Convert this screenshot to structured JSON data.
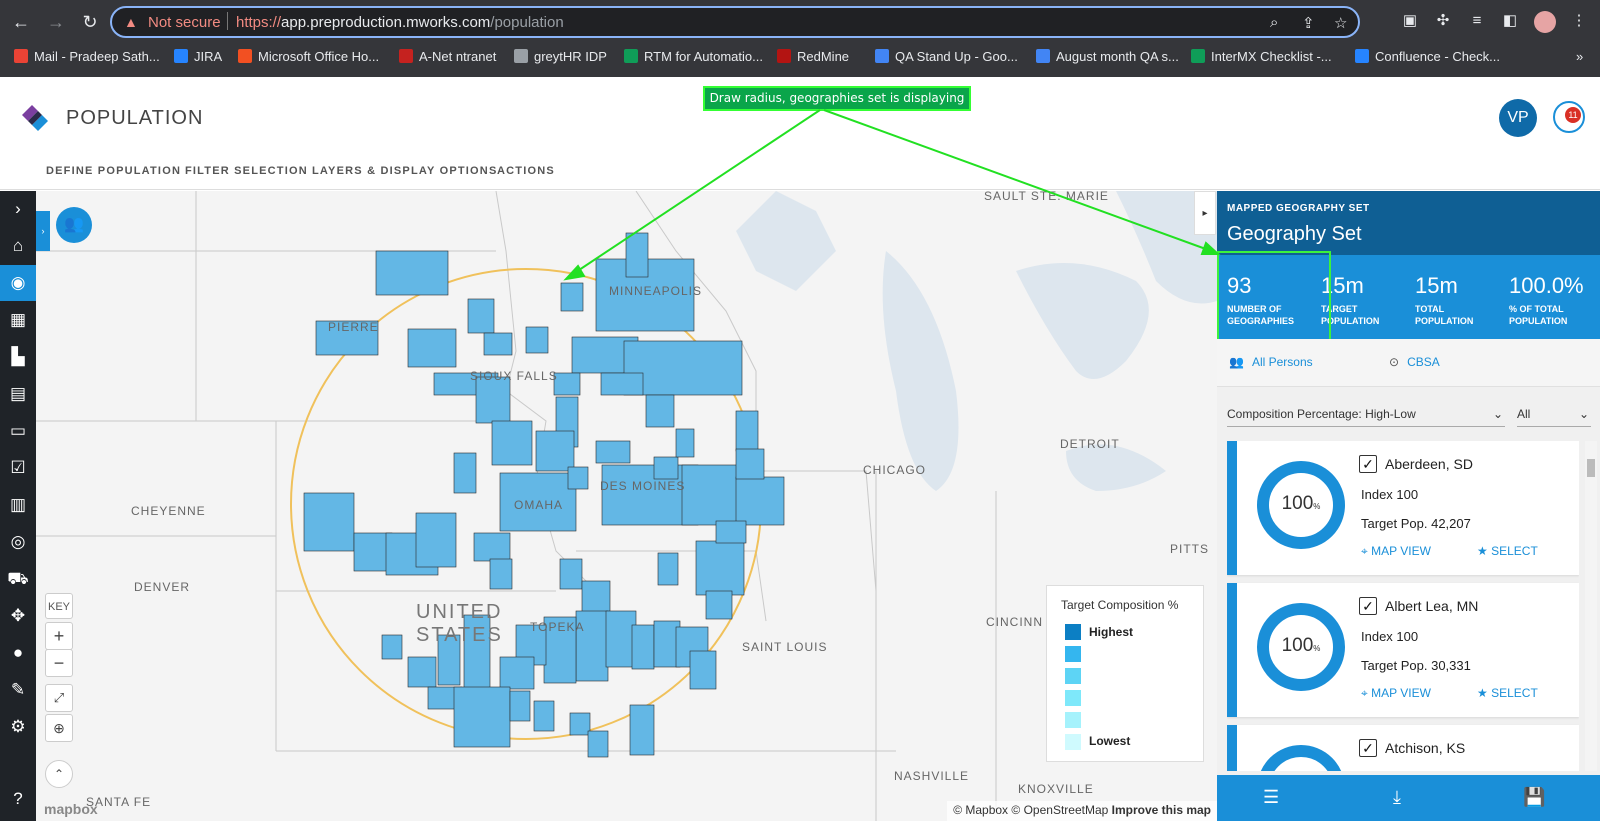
{
  "browser": {
    "warning_label": "Not secure",
    "url_scheme": "https://",
    "url_host": "app.preproduction.mworks.com",
    "url_path": "/population",
    "bookmarks": [
      {
        "label": "Mail - Pradeep Sath...",
        "color": "#ea4335"
      },
      {
        "label": "JIRA",
        "color": "#2684ff"
      },
      {
        "label": "Microsoft Office Ho...",
        "color": "#f25022"
      },
      {
        "label": "A-Net ntranet",
        "color": "#c5221f"
      },
      {
        "label": "greytHR IDP",
        "color": "#9aa0a6"
      },
      {
        "label": "RTM for Automatio...",
        "color": "#0f9d58"
      },
      {
        "label": "RedMine",
        "color": "#b31412"
      },
      {
        "label": "QA Stand Up - Goo...",
        "color": "#4285f4"
      },
      {
        "label": "August month QA s...",
        "color": "#4285f4"
      },
      {
        "label": "InterMX Checklist -...",
        "color": "#0f9d58"
      },
      {
        "label": "Confluence - Check...",
        "color": "#2684ff"
      }
    ]
  },
  "app": {
    "title": "POPULATION",
    "menu": [
      "DEFINE POPULATION",
      "FILTER SELECTION",
      "LAYERS & DISPLAY OPTIONS",
      "ACTIONS"
    ],
    "user_initials": "VP",
    "notification_count": "11"
  },
  "annotation": "Draw radius, geographies set is displaying",
  "map": {
    "labels": {
      "sault": "SAULT STE. MARIE",
      "minneapolis": "MINNEAPOLIS",
      "pierre": "PIERRE",
      "sioux": "SIOUX FALLS",
      "detroit": "DETROIT",
      "chicago": "CHICAGO",
      "cheyenne": "CHEYENNE",
      "omaha": "OMAHA",
      "desmoines": "DES MOINES",
      "pitts": "PITTS",
      "denver": "DENVER",
      "us1": "UNITED",
      "us2": "STATES",
      "topeka": "TOPEKA",
      "cincinn": "CINCINN",
      "saintlouis": "SAINT LOUIS",
      "nashville": "NASHVILLE",
      "knoxville": "KNOXVILLE",
      "santafe": "SANTA FE"
    },
    "key_label": "KEY",
    "zoom_in": "+",
    "zoom_out": "−",
    "legend_title": "Target Composition %",
    "legend_high": "Highest",
    "legend_low": "Lowest",
    "legend_colors": [
      "#0c7fc4",
      "#34b6ef",
      "#5dd4f5",
      "#7ee8fa",
      "#a5f2fc",
      "#cffafe"
    ],
    "attribution_mapbox": "© Mapbox",
    "attribution_osm": "© OpenStreetMap",
    "attribution_improve": "Improve this map",
    "brand": "mapbox"
  },
  "panel": {
    "subtitle": "MAPPED GEOGRAPHY SET",
    "title": "Geography Set",
    "stats": [
      {
        "value": "93",
        "label": "NUMBER OF GEOGRAPHIES"
      },
      {
        "value": "15m",
        "label": "TARGET POPULATION"
      },
      {
        "value": "15m",
        "label": "TOTAL POPULATION"
      },
      {
        "value": "100.0%",
        "label": "% OF TOTAL POPULATION"
      }
    ],
    "filter_persons": "All Persons",
    "filter_cbsa": "CBSA",
    "sort_label": "Composition Percentage: High-Low",
    "all_label": "All",
    "cards": [
      {
        "name": "Aberdeen, SD",
        "pct": "100",
        "index": "Index 100",
        "target": "Target Pop. 42,207"
      },
      {
        "name": "Albert Lea, MN",
        "pct": "100",
        "index": "Index 100",
        "target": "Target Pop. 30,331"
      },
      {
        "name": "Atchison, KS",
        "pct": "100",
        "index": "",
        "target": ""
      }
    ],
    "map_view": "MAP VIEW",
    "select": "SELECT"
  }
}
